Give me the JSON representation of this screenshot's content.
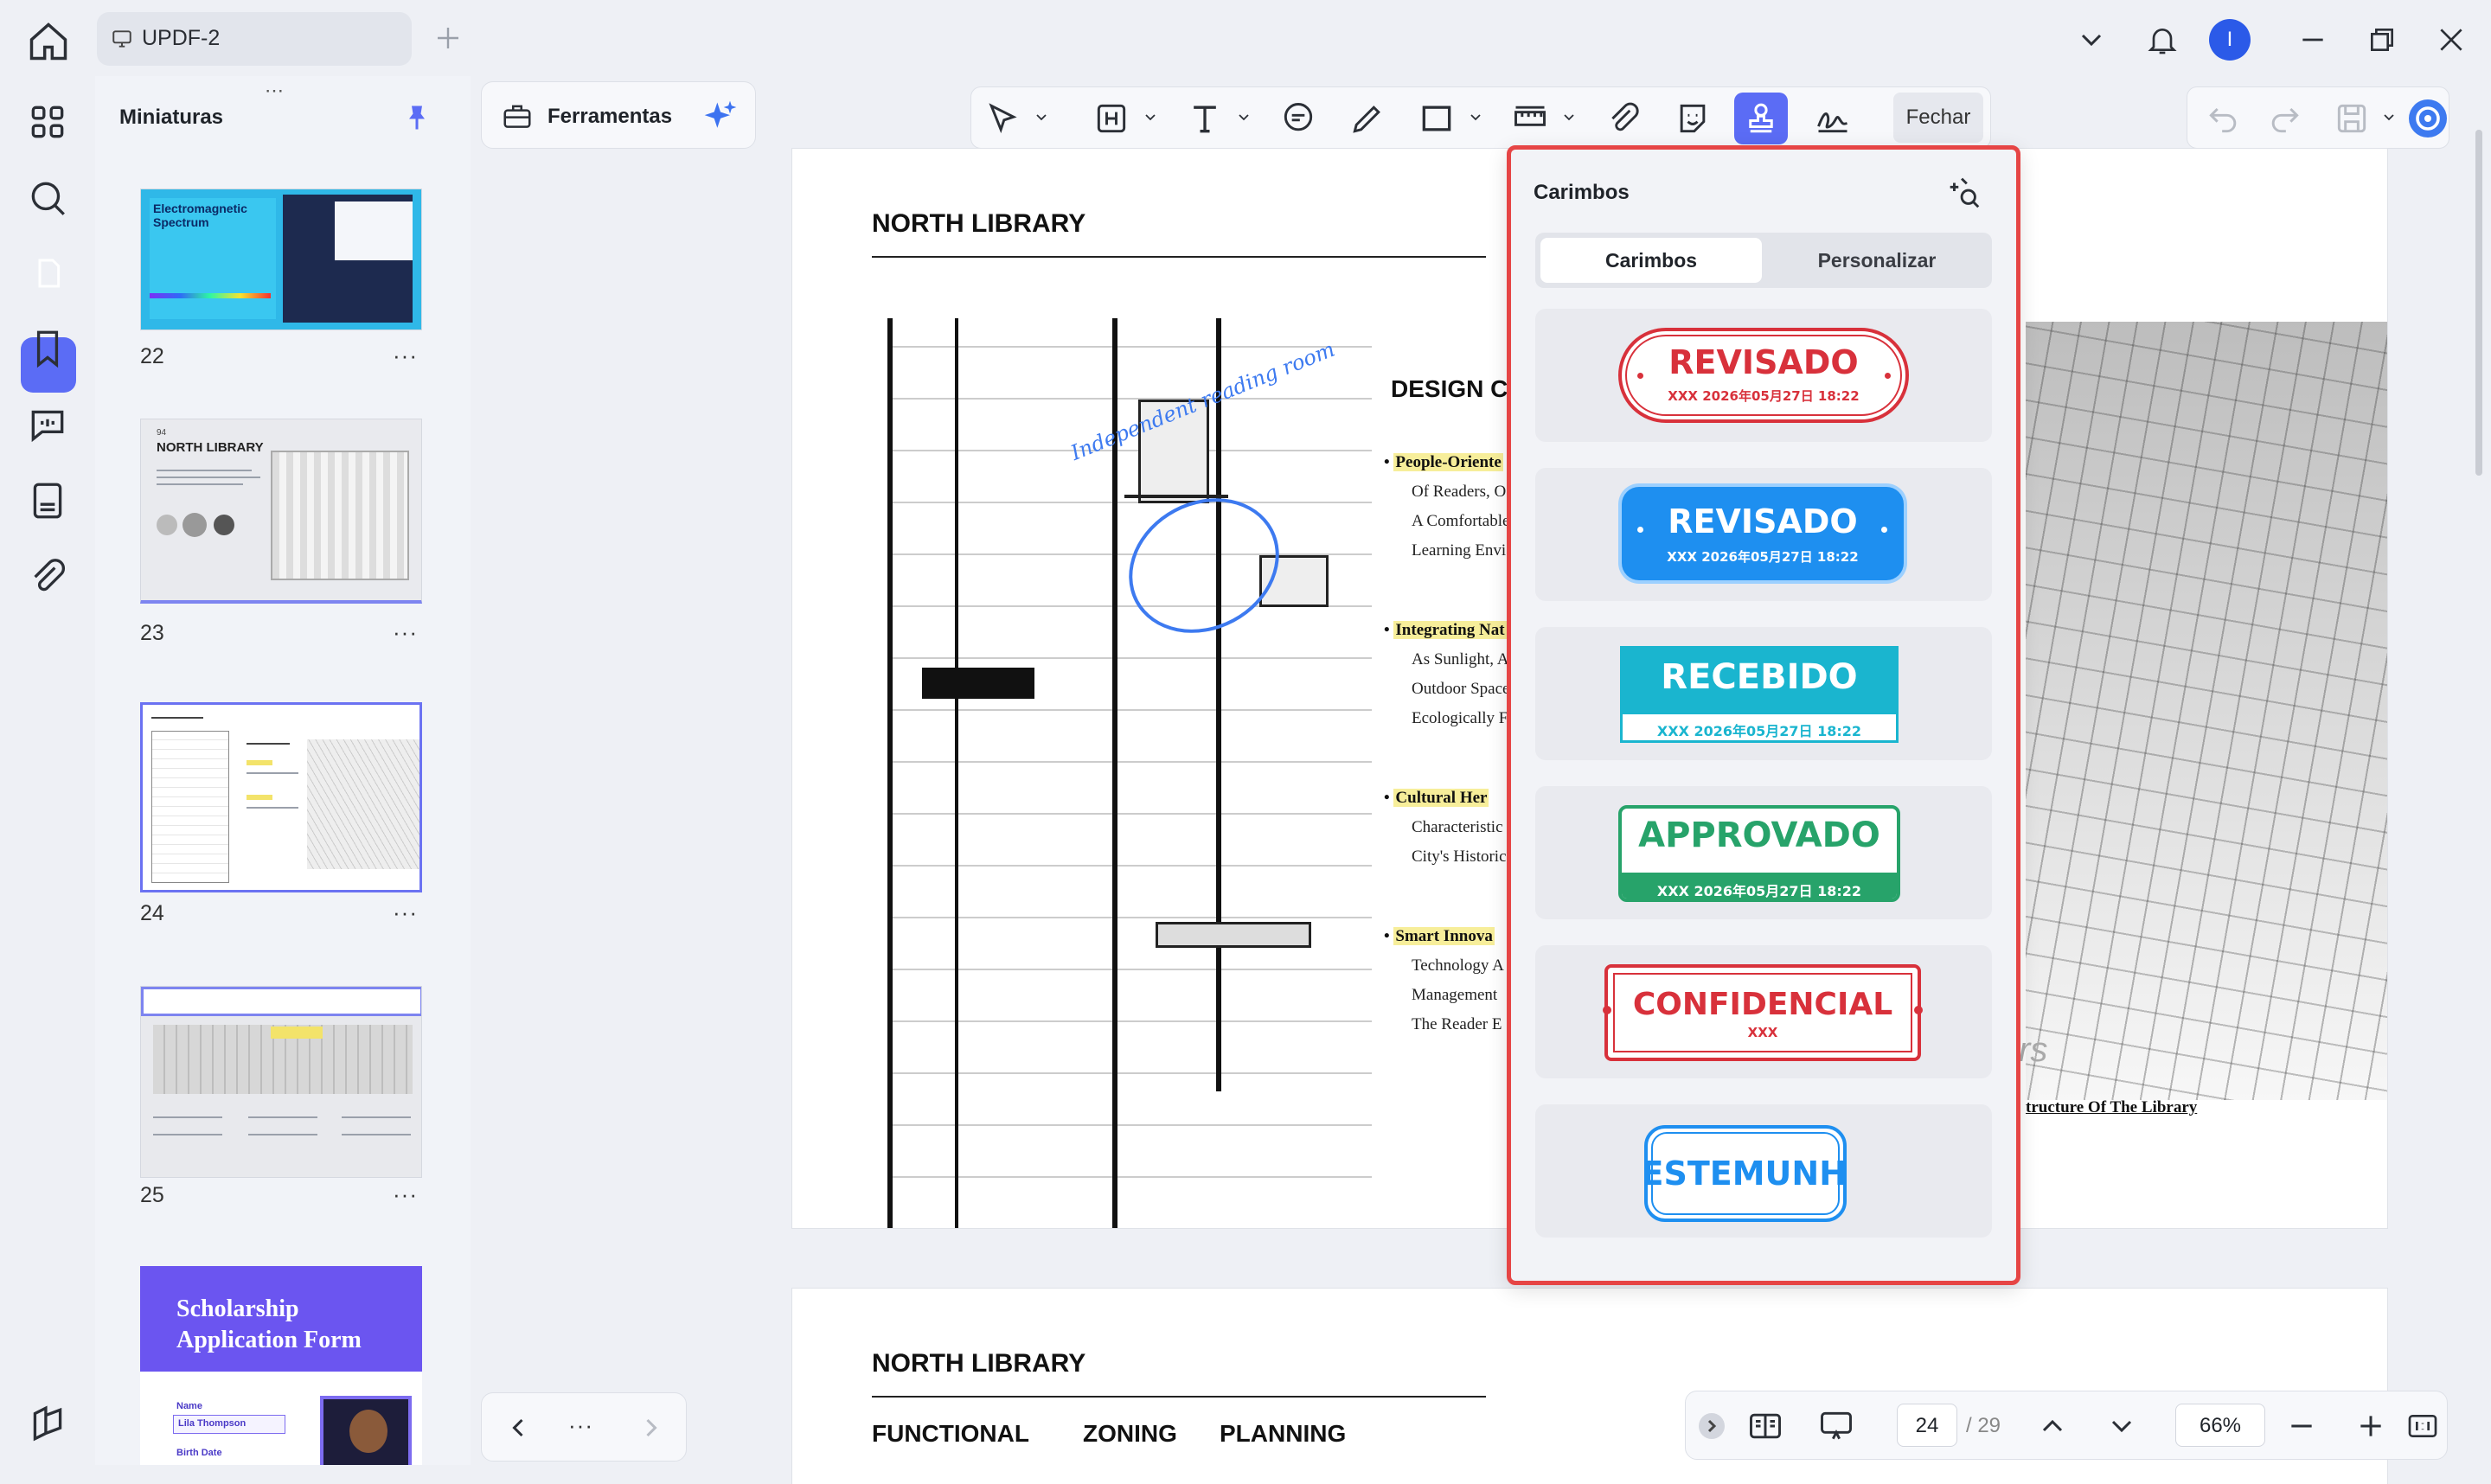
{
  "tab": {
    "label": "UPDF-2"
  },
  "user": {
    "initial": "I"
  },
  "thumbnails": {
    "title": "Miniaturas",
    "pages": [
      {
        "num": "22",
        "more": "···"
      },
      {
        "num": "23",
        "more": "···"
      },
      {
        "num": "24",
        "more": "···"
      },
      {
        "num": "25",
        "more": "···"
      }
    ],
    "thumb22_title_line1": "Electromagnetic",
    "thumb22_title_line2": "Spectrum",
    "thumb23_title": "NORTH LIBRARY",
    "thumb23_num": "94",
    "thumb26_title_line1": "Scholarship",
    "thumb26_title_line2": "Application Form",
    "thumb26_field1_label": "Name",
    "thumb26_field1_value": "Lila Thompson",
    "thumb26_field2_label": "Birth Date"
  },
  "tools": {
    "label": "Ferramentas"
  },
  "toolbar": {
    "close_label": "Fechar"
  },
  "stamps": {
    "title": "Carimbos",
    "tabs": [
      {
        "label": "Carimbos",
        "active": true
      },
      {
        "label": "Personalizar",
        "active": false
      }
    ],
    "items": [
      {
        "label": "REVISADO",
        "sub": "XXX 2026年05月27日 18:22",
        "color": "#d8313b",
        "style": "outline"
      },
      {
        "label": "REVISADO",
        "sub": "XXX 2026年05月27日 18:22",
        "color": "#1e8ff0",
        "style": "filled"
      },
      {
        "label": "RECEBIDO",
        "sub": "XXX 2026年05月27日 18:22",
        "color": "#1ab5cf",
        "style": "filled-split"
      },
      {
        "label": "APPROVADO",
        "sub": "XXX 2026年05月27日 18:22",
        "color": "#27a36a",
        "style": "filled-split"
      },
      {
        "label": "CONFIDENCIAL",
        "sub": "XXX",
        "color": "#d8313b",
        "style": "outline-rect"
      },
      {
        "label": "TESTEMUNHA",
        "sub": "",
        "color": "#1e8ff0",
        "style": "outline-pill"
      }
    ]
  },
  "document": {
    "page1": {
      "title": "NORTH LIBRARY",
      "section": "DESIGN C",
      "annotation": "Independent reading room",
      "bullets": [
        {
          "head": "People-Oriente",
          "lines": [
            "Of Readers, O",
            "A Comfortable",
            "Learning Envi"
          ]
        },
        {
          "head": "Integrating Nat",
          "lines": [
            "As Sunlight, A",
            "Outdoor Space",
            "Ecologically F"
          ]
        },
        {
          "head": "Cultural Her",
          "lines": [
            "Characteristic",
            "City's Historic"
          ]
        },
        {
          "head": "Smart Innova",
          "lines": [
            "Technology A",
            "Management",
            "The Reader E"
          ]
        }
      ],
      "caption_fragment": "rs",
      "caption": "tructure Of The Library"
    },
    "page2": {
      "title": "NORTH LIBRARY",
      "subtitle": [
        "FUNCTIONAL",
        "ZONING",
        "PLANNING"
      ]
    }
  },
  "navigation": {
    "more": "···",
    "current_page": "24",
    "total_pages": "/ 29",
    "zoom": "66%"
  }
}
